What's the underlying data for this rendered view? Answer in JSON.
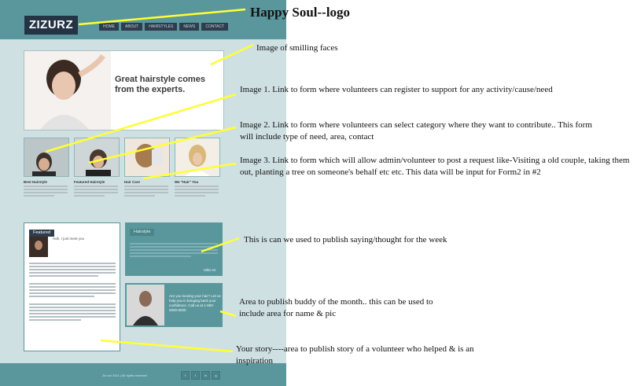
{
  "site": {
    "logo_text": "ZIZURZ",
    "nav": [
      "HOME",
      "ABOUT",
      "HAIRSTYLES",
      "NEWS",
      "CONTACT"
    ],
    "hero_tagline": "Great hairstyle comes from the experts.",
    "thumbs": [
      {
        "title": "Best Hairstyle"
      },
      {
        "title": "Featured Hairstyle"
      },
      {
        "title": "Hair Care"
      },
      {
        "title": "We \"Hair\" You"
      }
    ],
    "featured": {
      "title": "Featured",
      "name": "Hah. I just meet you"
    },
    "hairstyle": {
      "title": "Hairstyle",
      "author": "Mike M."
    },
    "buddy": {
      "text": "Are you loosing your hair? Let us help you in bringing back your confidence. Call us at 1-800-0000-0000"
    },
    "footer": {
      "copyright": "Ziz.urz 2011 | All rights reserved"
    },
    "social": [
      "f",
      "t",
      "in",
      "g"
    ]
  },
  "annotations": {
    "logo": "Happy Soul--logo",
    "hero": "Image of smilling faces",
    "image1": "Image 1. Link to form where volunteers can register to support for any activity/cause/need",
    "image2": "Image 2. Link to form where volunteers can select category where they want to contribute.. This form will include type of need, area, contact",
    "image3": "Image 3. Link to form which will allow admin/volunteer to post a request like-Visiting a old couple, taking them out, planting a tree on someone's behalf etc etc. This data will be input for Form2 in #2",
    "saying": "This is can we used to publish saying/thought for the week",
    "buddy": "Area to publish buddy of the month.. this can be used to include area for name & pic",
    "story": "Your story----area to publish story of a volunteer who helped & is an inspiration"
  },
  "colors": {
    "teal": "#5a979d",
    "navy": "#253445",
    "arrow": "#ffff33"
  }
}
